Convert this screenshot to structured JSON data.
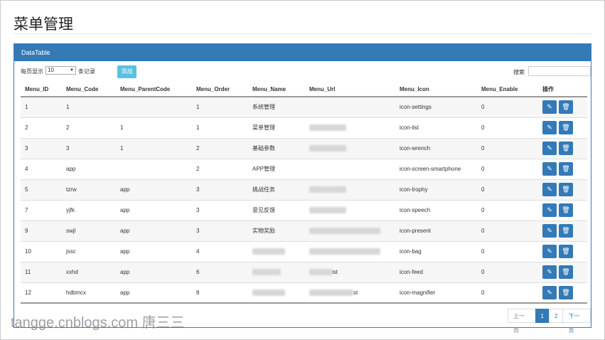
{
  "page": {
    "title": "菜单管理"
  },
  "panel": {
    "heading": "DataTable"
  },
  "controls": {
    "length_prefix": "每页显示",
    "length_value": "10",
    "length_suffix": "条记录",
    "add_label": "添加",
    "search_label": "搜索",
    "search_value": ""
  },
  "table": {
    "headers": [
      "Menu_ID",
      "Menu_Code",
      "Menu_ParentCode",
      "Menu_Order",
      "Menu_Name",
      "Menu_Url",
      "Menu_Icon",
      "Menu_Enable",
      "操作"
    ],
    "rows": [
      {
        "id": "1",
        "code": "1",
        "parent": "",
        "order": "1",
        "name": "系统管理",
        "url": "",
        "icon": "icon-settings",
        "enable": "0"
      },
      {
        "id": "2",
        "code": "2",
        "parent": "1",
        "order": "1",
        "name": "菜单管理",
        "url": "",
        "icon": "icon-list",
        "enable": "0"
      },
      {
        "id": "3",
        "code": "3",
        "parent": "1",
        "order": "2",
        "name": "基础参数",
        "url": "",
        "icon": "icon-wrench",
        "enable": "0"
      },
      {
        "id": "4",
        "code": "app",
        "parent": "",
        "order": "2",
        "name": "APP管理",
        "url": "",
        "icon": "icon-screen-smartphone",
        "enable": "0"
      },
      {
        "id": "5",
        "code": "tzrw",
        "parent": "app",
        "order": "3",
        "name": "挑战任务",
        "url": "",
        "icon": "icon-trophy",
        "enable": "0"
      },
      {
        "id": "7",
        "code": "yjfk",
        "parent": "app",
        "order": "3",
        "name": "意见反馈",
        "url": "",
        "icon": "icon-speech",
        "enable": "0"
      },
      {
        "id": "9",
        "code": "swjl",
        "parent": "app",
        "order": "3",
        "name": "实物奖励",
        "url": "",
        "icon": "icon-present",
        "enable": "0"
      },
      {
        "id": "10",
        "code": "jssc",
        "parent": "app",
        "order": "4",
        "name": "",
        "url": "",
        "icon": "icon-bag",
        "enable": "0"
      },
      {
        "id": "11",
        "code": "xxhd",
        "parent": "app",
        "order": "6",
        "name": "",
        "url": "ist",
        "icon": "icon-feed",
        "enable": "0"
      },
      {
        "id": "12",
        "code": "hdbmcx",
        "parent": "app",
        "order": "8",
        "name": "",
        "url": "st",
        "icon": "icon-magnifier",
        "enable": "0"
      }
    ],
    "action_icons": {
      "edit": "edit-icon",
      "delete": "trash-icon"
    }
  },
  "pager": {
    "prev": "上一页",
    "pages": [
      "1",
      "2"
    ],
    "active": "1",
    "next": "下一页"
  },
  "watermark": "tangge.cnblogs.com 唐三三",
  "colors": {
    "primary": "#337ab7",
    "add_button": "#5bc0de"
  }
}
